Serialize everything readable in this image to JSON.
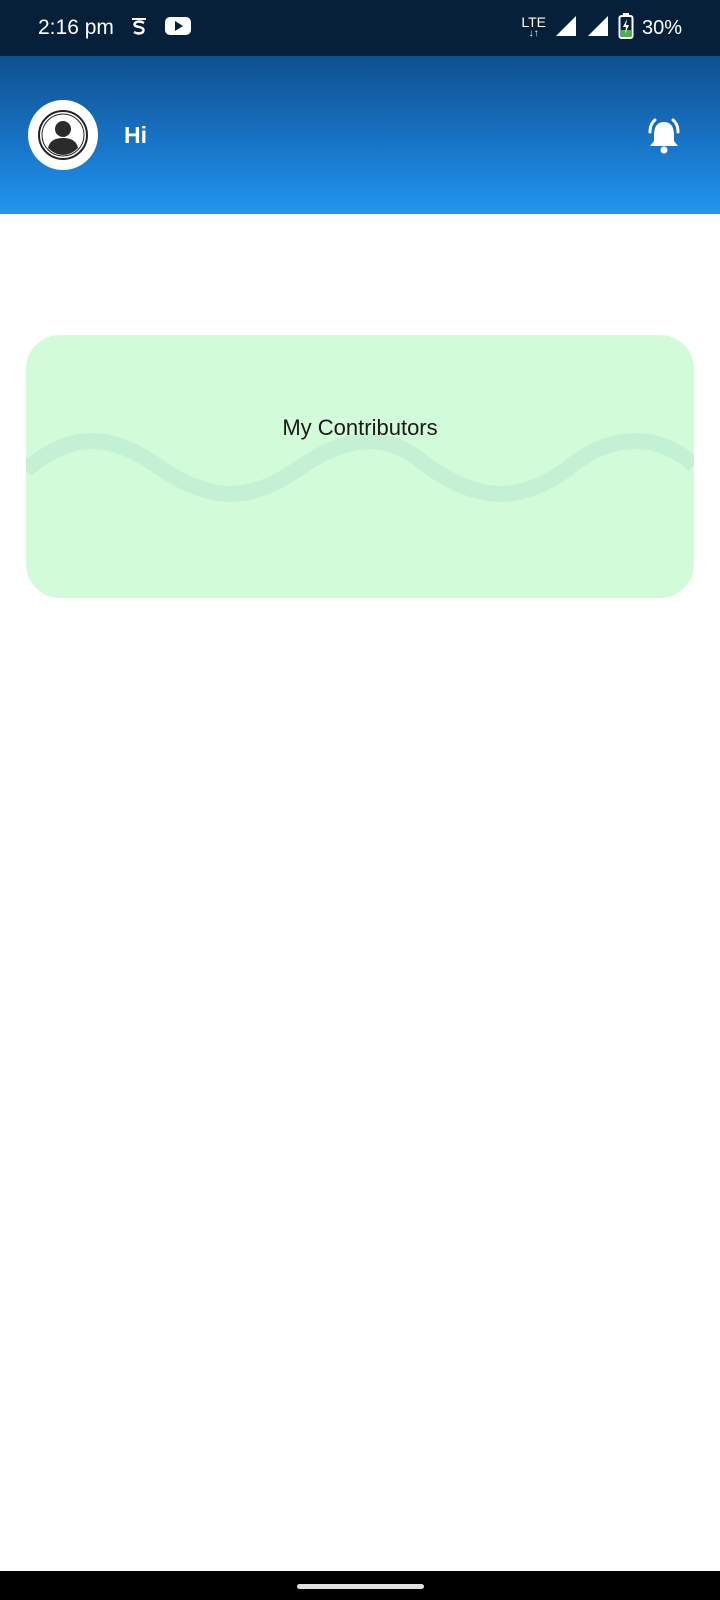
{
  "status_bar": {
    "time": "2:16 pm",
    "network": "LTE",
    "battery": "30%",
    "icons": [
      "notification-s-icon",
      "youtube-icon",
      "signal-icon",
      "signal-icon",
      "battery-charging-icon"
    ]
  },
  "header": {
    "greeting": "Hi",
    "avatar_icon": "user-avatar-icon",
    "notification_icon": "bell-icon",
    "gradient": [
      "#0f4f8e",
      "#2195ef"
    ]
  },
  "card": {
    "title": "My Contributors",
    "background": "#d2fbda"
  }
}
